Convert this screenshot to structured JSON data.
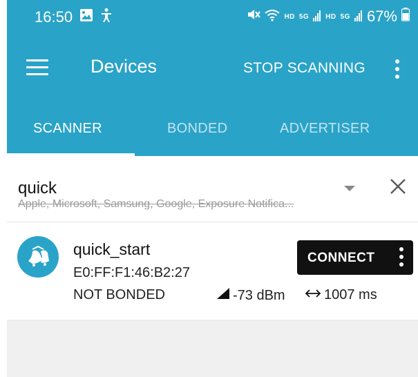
{
  "status_bar": {
    "time": "16:50",
    "network_label_1": "HD",
    "network_label_2": "5G",
    "network_label_3": "HD",
    "network_label_4": "5G",
    "battery": "67%"
  },
  "app_bar": {
    "title": "Devices",
    "action": "STOP SCANNING"
  },
  "tabs": [
    {
      "label": "SCANNER",
      "active": true
    },
    {
      "label": "BONDED",
      "active": false
    },
    {
      "label": "ADVERTISER",
      "active": false
    }
  ],
  "filter": {
    "value": "quick",
    "hint": "Apple, Microsoft, Samsung, Google, Exposure Notifica..."
  },
  "device": {
    "name": "quick_start",
    "address": "E0:FF:F1:46:B2:27",
    "bond_state": "NOT BONDED",
    "rssi": "-73 dBm",
    "interval": "1007 ms",
    "connect_label": "CONNECT"
  },
  "colors": {
    "primary": "#2aa3c8",
    "button": "#111111"
  }
}
